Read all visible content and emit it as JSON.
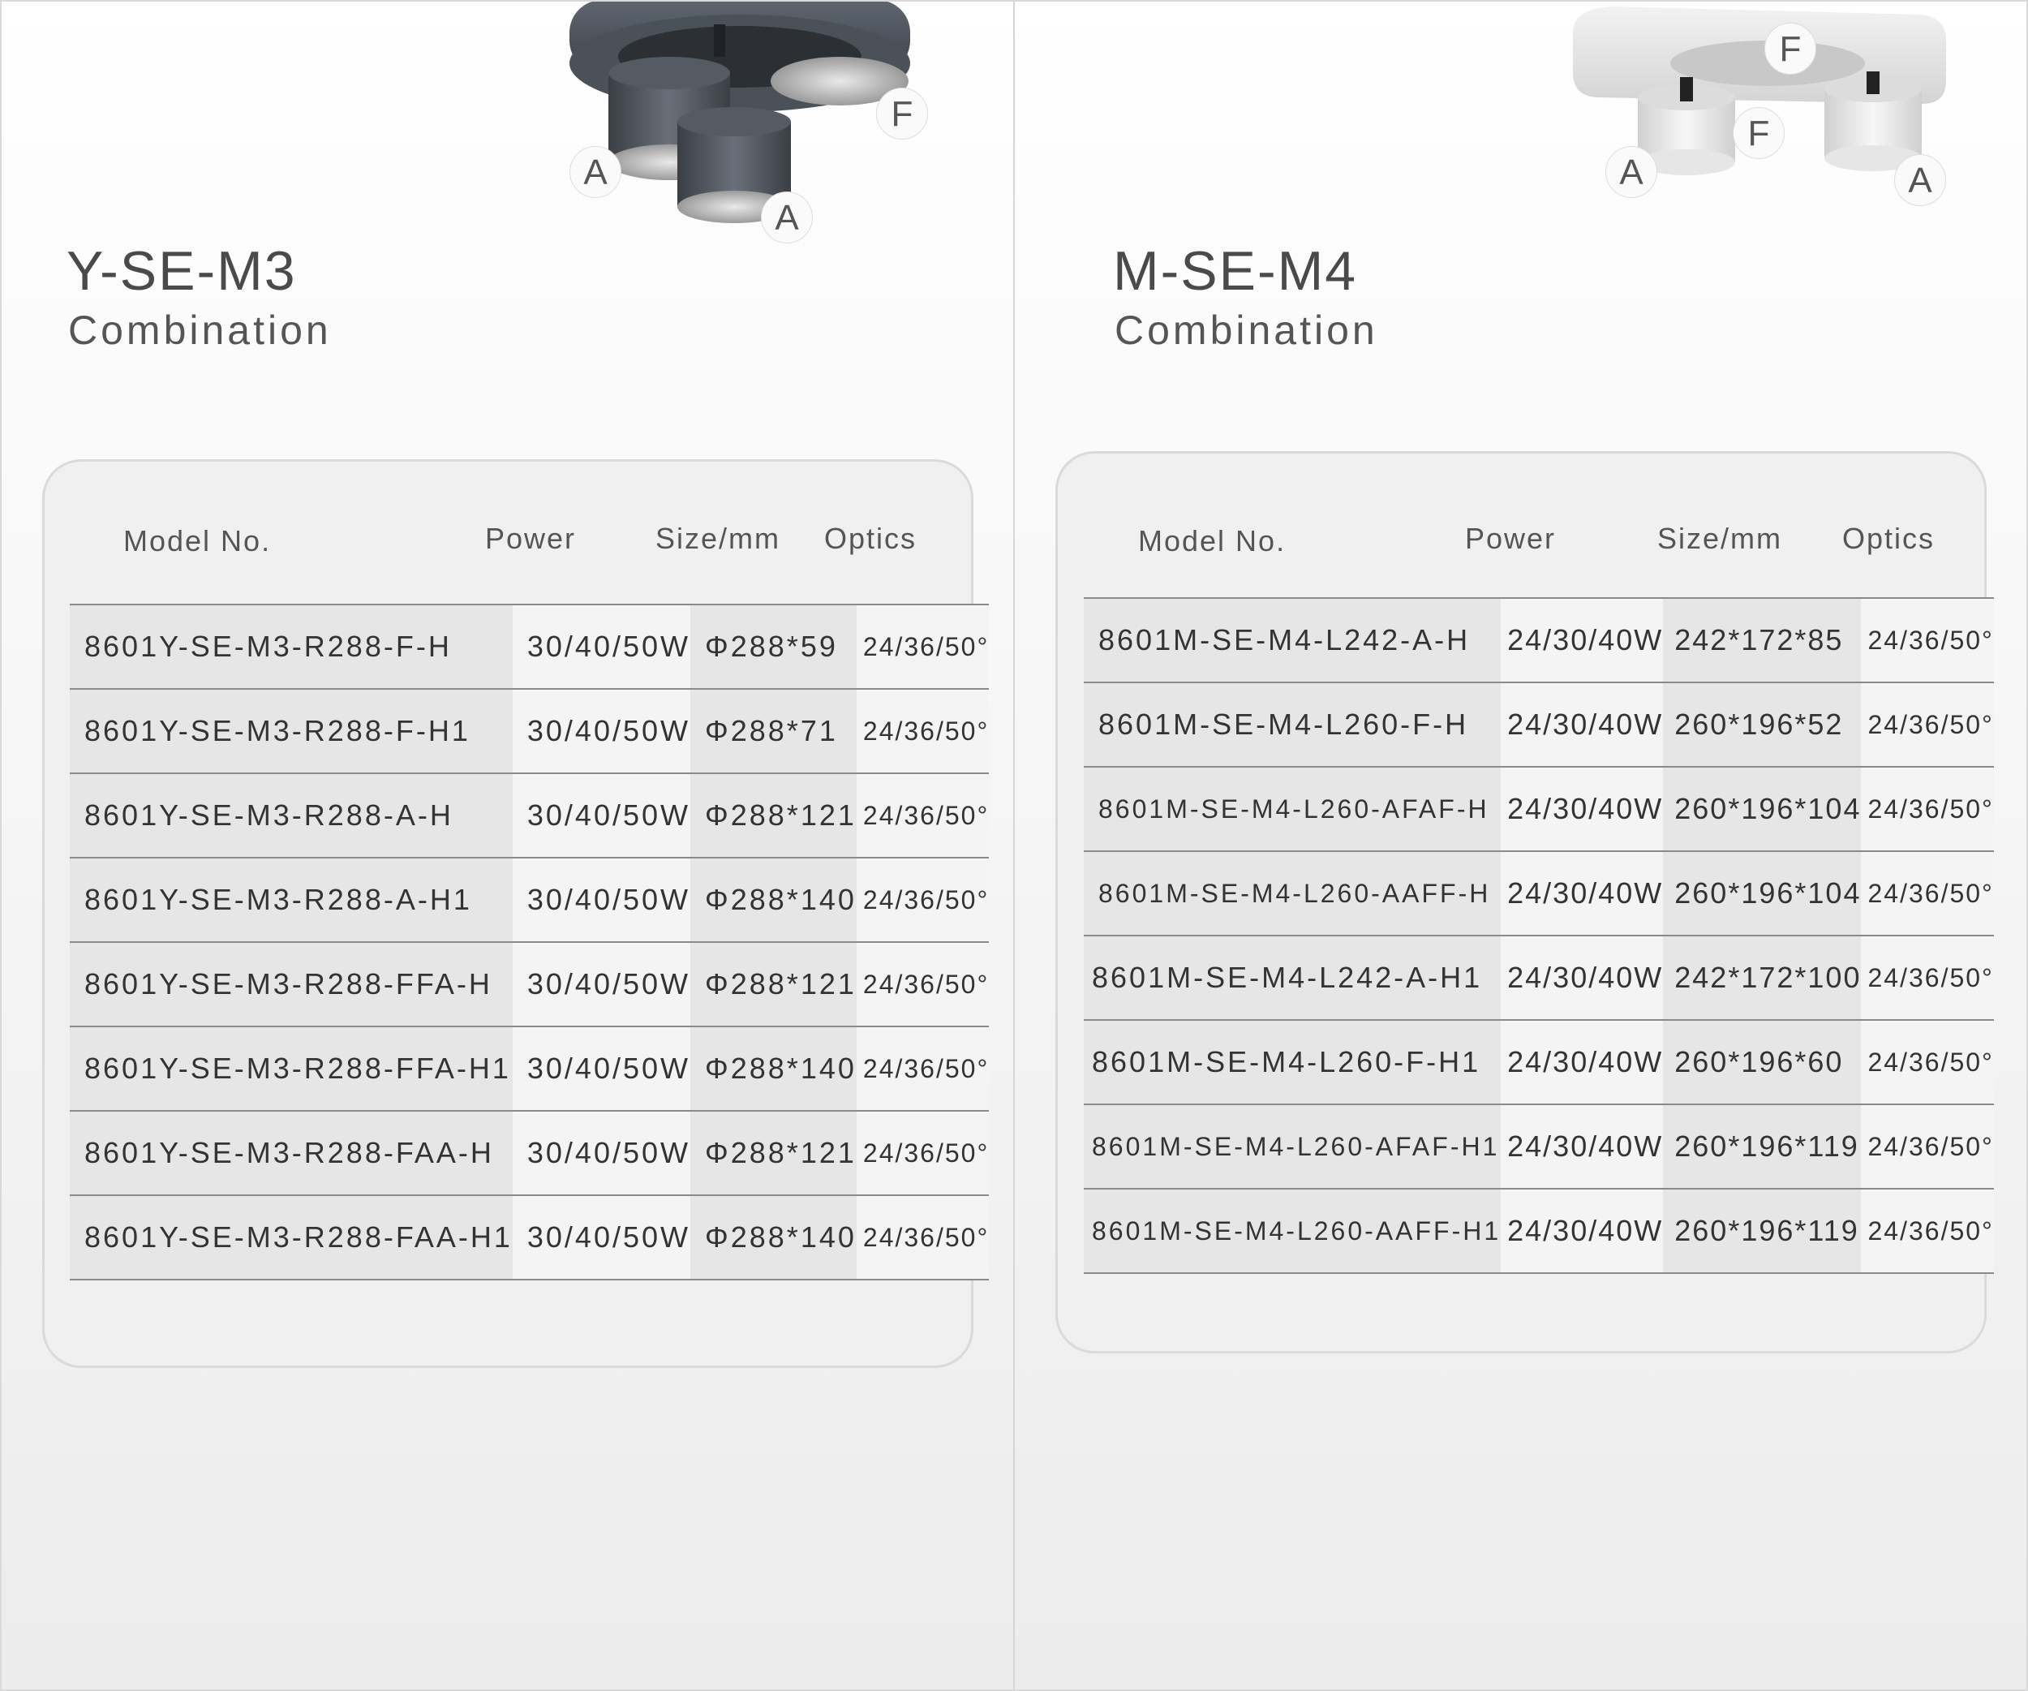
{
  "left": {
    "title": "Y-SE-M3",
    "subtitle": "Combination",
    "labels": [
      "A",
      "A",
      "F"
    ],
    "headers": {
      "model": "Model No.",
      "power": "Power",
      "size": "Size/mm",
      "optics": "Optics"
    },
    "rows": [
      {
        "model": "8601Y-SE-M3-R288-F-H",
        "power": "30/40/50W",
        "size": "Φ288*59",
        "optics": "24/36/50°"
      },
      {
        "model": "8601Y-SE-M3-R288-F-H1",
        "power": "30/40/50W",
        "size": "Φ288*71",
        "optics": "24/36/50°"
      },
      {
        "model": "8601Y-SE-M3-R288-A-H",
        "power": "30/40/50W",
        "size": "Φ288*121",
        "optics": "24/36/50°"
      },
      {
        "model": "8601Y-SE-M3-R288-A-H1",
        "power": "30/40/50W",
        "size": "Φ288*140",
        "optics": "24/36/50°"
      },
      {
        "model": "8601Y-SE-M3-R288-FFA-H",
        "power": "30/40/50W",
        "size": "Φ288*121",
        "optics": "24/36/50°"
      },
      {
        "model": "8601Y-SE-M3-R288-FFA-H1",
        "power": "30/40/50W",
        "size": "Φ288*140",
        "optics": "24/36/50°"
      },
      {
        "model": "8601Y-SE-M3-R288-FAA-H",
        "power": "30/40/50W",
        "size": "Φ288*121",
        "optics": "24/36/50°"
      },
      {
        "model": "8601Y-SE-M3-R288-FAA-H1",
        "power": "30/40/50W",
        "size": "Φ288*140",
        "optics": "24/36/50°"
      }
    ]
  },
  "right": {
    "title": "M-SE-M4",
    "subtitle": "Combination",
    "labels": [
      "F",
      "F",
      "A",
      "A"
    ],
    "headers": {
      "model": "Model No.",
      "power": "Power",
      "size": "Size/mm",
      "optics": "Optics"
    },
    "rows": [
      {
        "model": "8601M-SE-M4-L242-A-H",
        "power": "24/30/40W",
        "size": "242*172*85",
        "optics": "24/36/50°"
      },
      {
        "model": "8601M-SE-M4-L260-F-H",
        "power": "24/30/40W",
        "size": "260*196*52",
        "optics": "24/36/50°"
      },
      {
        "model": "8601M-SE-M4-L260-AFAF-H",
        "power": "24/30/40W",
        "size": "260*196*104",
        "optics": "24/36/50°"
      },
      {
        "model": "8601M-SE-M4-L260-AAFF-H",
        "power": "24/30/40W",
        "size": "260*196*104",
        "optics": "24/36/50°"
      },
      {
        "model": "8601M-SE-M4-L242-A-H1",
        "power": "24/30/40W",
        "size": "242*172*100",
        "optics": "24/36/50°"
      },
      {
        "model": "8601M-SE-M4-L260-F-H1",
        "power": "24/30/40W",
        "size": "260*196*60",
        "optics": "24/36/50°"
      },
      {
        "model": "8601M-SE-M4-L260-AFAF-H1",
        "power": "24/30/40W",
        "size": "260*196*119",
        "optics": "24/36/50°"
      },
      {
        "model": "8601M-SE-M4-L260-AAFF-H1",
        "power": "24/30/40W",
        "size": "260*196*119",
        "optics": "24/36/50°"
      }
    ]
  }
}
